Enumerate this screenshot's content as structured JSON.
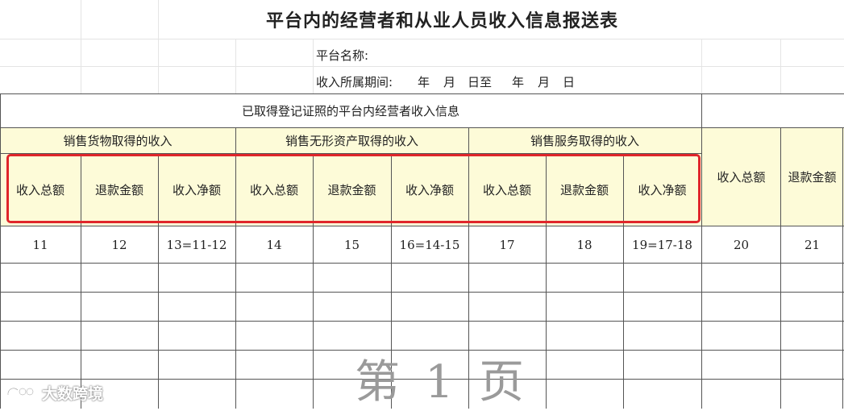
{
  "title": "平台内的经营者和从业人员收入信息报送表",
  "meta": {
    "platform_name_label": "平台名称:",
    "period_label": "收入所属期间:",
    "period_year1": "年",
    "period_month1": "月",
    "period_day1": "日至",
    "period_year2": "年",
    "period_month2": "月",
    "period_day2": "日"
  },
  "header": {
    "section_title": "已取得登记证照的平台内经营者收入信息",
    "groups": [
      "销售货物取得的收入",
      "销售无形资产取得的收入",
      "销售服务取得的收入"
    ],
    "columns": [
      "收入总额",
      "退款金额",
      "收入净额",
      "收入总额",
      "退款金额",
      "收入净额",
      "收入总额",
      "退款金额",
      "收入净额",
      "收入总额",
      "退款金额"
    ],
    "numbers": [
      "11",
      "12",
      "13=11-12",
      "14",
      "15",
      "16=14-15",
      "17",
      "18",
      "19=17-18",
      "20",
      "21"
    ]
  },
  "footer": {
    "page_chars": [
      "第",
      "1",
      "页"
    ],
    "watermark_text": "大数跨境"
  },
  "colors": {
    "header_fill": "#fdfbd8",
    "highlight_border": "#e0262b"
  }
}
